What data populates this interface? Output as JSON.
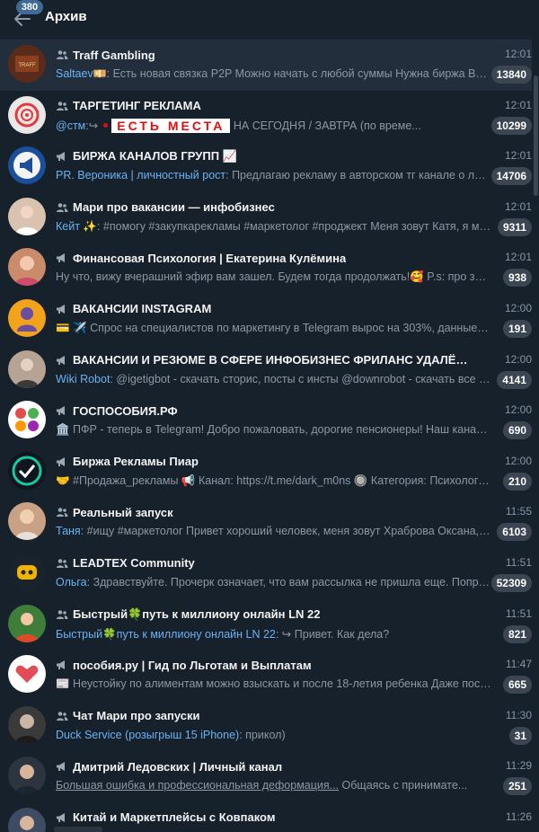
{
  "header": {
    "title": "Архив",
    "unread_badge": "380",
    "back_icon": "arrow-left-icon"
  },
  "colors": {
    "background": "#17212b",
    "active_row": "#232e3c",
    "sender": "#6ab2f2",
    "badge": "#3b4652"
  },
  "chats": [
    {
      "type": "group",
      "title": "Traff Gambling",
      "time": "12:01",
      "sender": "Saltaev",
      "sender_emoji": "💴",
      "text": ": Есть новая связка P2P Можно начать с любой суммы  Нужна биржа Bybi...",
      "count": "13840",
      "avatar_color": "#5a2b1a"
    },
    {
      "type": "group",
      "title": "ТАРГЕТИНГ РЕКЛАМА",
      "time": "12:01",
      "sender": "@стм",
      "text_pre": ":",
      "banner": "ЕСТЬ МЕСТА",
      "text": "   НА СЕГОДНЯ / ЗАВТРА      (по време...",
      "count": "10299",
      "avatar_color": "#e8e8e8"
    },
    {
      "type": "channel",
      "title": "БИРЖА КАНАЛОВ ГРУПП 📈",
      "time": "12:01",
      "sender": "PR. Вероника | личностный рост",
      "text": ": Предлагаю рекламу в авторском тг канале о личн...",
      "count": "14706",
      "avatar_color": "#1b4e9b"
    },
    {
      "type": "group",
      "title": "Мари про вакансии — инфобизнес",
      "time": "12:01",
      "sender": "Кейт ✨",
      "text": ": #помогу #закупкарекламы #маркетолог #проджект  Меня зовут Катя, я ма...",
      "count": "9311",
      "avatar_color": "#d9c2b0"
    },
    {
      "type": "channel",
      "title": "Финансовая Психология | Екатерина Кулёмина",
      "time": "12:01",
      "sender": "",
      "text": "Ну что, вижу вчерашний эфир вам зашел. Будем тогда продолжать!🥰  P.s: про запис...",
      "count": "938",
      "avatar_color": "#c98b6a"
    },
    {
      "type": "channel",
      "title": "ВАКАНСИИ INSTAGRAM",
      "time": "12:00",
      "sender": "",
      "text": "💳 ✈️  Спрос на специалистов по маркетингу в Telegram вырос на 303%, данные Head...",
      "count": "191",
      "avatar_color": "#f3a21c"
    },
    {
      "type": "channel",
      "title": "ВАКАНСИИ И РЕЗЮМЕ В СФЕРЕ ИНФОБИЗНЕС ФРИЛАНС УДАЛЁННАЯ РАБОТА",
      "time": "12:00",
      "sender": "Wiki Robot",
      "text": ": @igetigbot - скачать сторис, посты с инсты @downrobot - скачать все с Ins...",
      "count": "4141",
      "avatar_color": "#b7a393"
    },
    {
      "type": "channel",
      "title": "ГОСПОСОБИЯ.РФ",
      "time": "12:00",
      "sender": "",
      "text": "🏛️ ПФР - теперь в Telegram!  Добро пожаловать, дорогие пенсионеры! Наш канал соз...",
      "count": "690",
      "avatar_color": "#ffffff"
    },
    {
      "type": "channel",
      "title": "Биржа Рекламы Пиар",
      "time": "12:00",
      "sender": "",
      "text": "🤝 #Продажа_рекламы  📢 Канал: https://t.me/dark_m0ns  🔘 Категория: Психология...",
      "count": "210",
      "avatar_color": "#10161d"
    },
    {
      "type": "group",
      "title": "Реальный запуск",
      "time": "11:55",
      "sender": "Таня",
      "text": ": #ищу #маркетолог  Привет хороший человек, меня зовут Храброва Оксана, и ...",
      "count": "6103",
      "avatar_color": "#c9a184"
    },
    {
      "type": "group",
      "title": "LEADTEX Community",
      "time": "11:51",
      "sender": "Ольга",
      "text": ": Здравствуйте. Прочерк означает, что вам рассылка не пришла еще. Попроб...",
      "count": "52309",
      "avatar_color": "#1a222c"
    },
    {
      "type": "group",
      "title": "Быстрый🍀путь к миллиону онлайн LN 22",
      "time": "11:51",
      "sender": "Быстрый🍀путь к миллиону онлайн LN 22",
      "text": ": ↪ Привет. Как дела?",
      "count": "821",
      "avatar_color": "#3f7d3a"
    },
    {
      "type": "channel",
      "title": "пособия.ру | Гид по Льготам и Выплатам",
      "time": "11:47",
      "sender": "",
      "text": "📰 Неустойку по алиментам можно взыскать и после 18-летия ребенка  Даже после ...",
      "count": "665",
      "avatar_color": "#ffffff"
    },
    {
      "type": "group",
      "title": "Чат Мари про запуски",
      "time": "11:30",
      "sender": "Duck Service (розыгрыш 15 iPhone)",
      "text": ": прикол)",
      "count": "31",
      "avatar_color": "#3a3a3a"
    },
    {
      "type": "channel",
      "title": "Дмитрий Ледовских | Личный канал",
      "time": "11:29",
      "sender": "",
      "text_underline": "Большая ошибка и профессиональная деформация...",
      "text": "  Общаясь с принимате...",
      "count": "251",
      "avatar_color": "#2c3440"
    },
    {
      "type": "channel",
      "title": "Китай и Маркетплейсы с Ковпаком",
      "time": "11:26",
      "sender": "",
      "text": "",
      "count": "",
      "avatar_color": "#3d4c63"
    }
  ]
}
